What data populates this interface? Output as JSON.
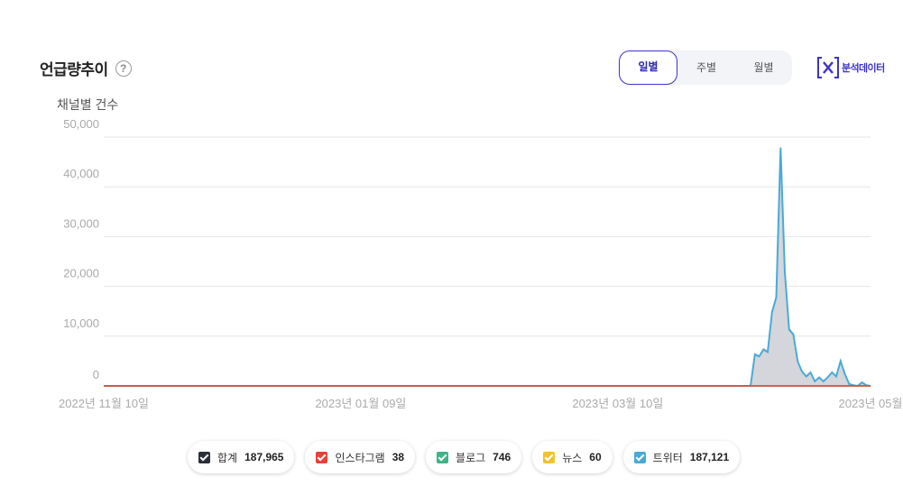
{
  "header": {
    "title": "언급량추이",
    "help_icon": "question-circle-icon",
    "periods": [
      "일별",
      "주별",
      "월별"
    ],
    "active_period": "일별",
    "export_label": "분석데이터",
    "export_icon": "excel-icon"
  },
  "chart_data": {
    "type": "area",
    "ylabel": "채널별 건수",
    "ylim": [
      0,
      50000
    ],
    "yticks": [
      "50,000",
      "40,000",
      "30,000",
      "20,000",
      "10,000",
      "0"
    ],
    "ytick_values": [
      50000,
      40000,
      30000,
      20000,
      10000,
      0
    ],
    "xticks": [
      "2022년 11월 10일",
      "2023년 01월 09일",
      "2023년 03월 10일",
      "2023년 05월"
    ],
    "xtick_dates": [
      "2022-11-10",
      "2023-01-09",
      "2023-03-10",
      "2023-05-08"
    ],
    "x_range": [
      "2022-11-10",
      "2023-05-08"
    ],
    "grid": true,
    "series": [
      {
        "name": "합계",
        "color": "#b9bcc4",
        "points": [
          [
            "2022-11-10",
            0
          ],
          [
            "2023-04-10",
            0
          ],
          [
            "2023-04-11",
            6500
          ],
          [
            "2023-04-12",
            6000
          ],
          [
            "2023-04-13",
            7500
          ],
          [
            "2023-04-14",
            7000
          ],
          [
            "2023-04-15",
            15000
          ],
          [
            "2023-04-16",
            18000
          ],
          [
            "2023-04-17",
            48000
          ],
          [
            "2023-04-18",
            23000
          ],
          [
            "2023-04-19",
            11500
          ],
          [
            "2023-04-20",
            10500
          ],
          [
            "2023-04-21",
            5000
          ],
          [
            "2023-04-22",
            3000
          ],
          [
            "2023-04-23",
            2000
          ],
          [
            "2023-04-24",
            2800
          ],
          [
            "2023-04-25",
            1000
          ],
          [
            "2023-04-26",
            1800
          ],
          [
            "2023-04-27",
            1000
          ],
          [
            "2023-04-28",
            1800
          ],
          [
            "2023-04-29",
            2800
          ],
          [
            "2023-04-30",
            2000
          ],
          [
            "2023-05-01",
            5200
          ],
          [
            "2023-05-02",
            2500
          ],
          [
            "2023-05-03",
            500
          ],
          [
            "2023-05-04",
            200
          ],
          [
            "2023-05-05",
            0
          ],
          [
            "2023-05-06",
            800
          ],
          [
            "2023-05-07",
            200
          ],
          [
            "2023-05-08",
            0
          ]
        ]
      },
      {
        "name": "트위터",
        "color": "#4aaad6",
        "points": [
          [
            "2022-11-10",
            0
          ],
          [
            "2023-04-10",
            0
          ],
          [
            "2023-04-11",
            6300
          ],
          [
            "2023-04-12",
            5900
          ],
          [
            "2023-04-13",
            7300
          ],
          [
            "2023-04-14",
            6800
          ],
          [
            "2023-04-15",
            14800
          ],
          [
            "2023-04-16",
            17800
          ],
          [
            "2023-04-17",
            47800
          ],
          [
            "2023-04-18",
            22800
          ],
          [
            "2023-04-19",
            11300
          ],
          [
            "2023-04-20",
            10300
          ],
          [
            "2023-04-21",
            4900
          ],
          [
            "2023-04-22",
            2900
          ],
          [
            "2023-04-23",
            1900
          ],
          [
            "2023-04-24",
            2700
          ],
          [
            "2023-04-25",
            900
          ],
          [
            "2023-04-26",
            1700
          ],
          [
            "2023-04-27",
            900
          ],
          [
            "2023-04-28",
            1700
          ],
          [
            "2023-04-29",
            2700
          ],
          [
            "2023-04-30",
            1900
          ],
          [
            "2023-05-01",
            5000
          ],
          [
            "2023-05-02",
            2400
          ],
          [
            "2023-05-03",
            400
          ],
          [
            "2023-05-04",
            150
          ],
          [
            "2023-05-05",
            0
          ],
          [
            "2023-05-06",
            700
          ],
          [
            "2023-05-07",
            150
          ],
          [
            "2023-05-08",
            0
          ]
        ]
      },
      {
        "name": "뉴스",
        "color": "#f2c231",
        "points": [
          [
            "2022-11-10",
            0
          ],
          [
            "2023-05-08",
            0
          ]
        ]
      },
      {
        "name": "블로그",
        "color": "#3fb489",
        "points": [
          [
            "2022-11-10",
            0
          ],
          [
            "2023-05-08",
            0
          ]
        ]
      },
      {
        "name": "인스타그램",
        "color": "#e6413d",
        "points": [
          [
            "2022-11-10",
            0
          ],
          [
            "2023-05-08",
            0
          ]
        ]
      }
    ]
  },
  "legend": [
    {
      "label": "합계",
      "count": "187,965",
      "color": "#2b2f3a"
    },
    {
      "label": "인스타그램",
      "count": "38",
      "color": "#e6413d"
    },
    {
      "label": "블로그",
      "count": "746",
      "color": "#3fb489"
    },
    {
      "label": "뉴스",
      "count": "60",
      "color": "#f2c231"
    },
    {
      "label": "트위터",
      "count": "187,121",
      "color": "#4aaad6"
    }
  ]
}
